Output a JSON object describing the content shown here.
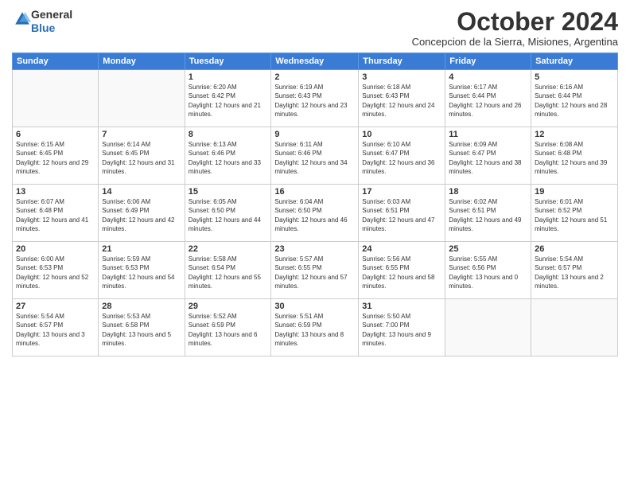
{
  "header": {
    "logo_general": "General",
    "logo_blue": "Blue",
    "month": "October 2024",
    "location": "Concepcion de la Sierra, Misiones, Argentina"
  },
  "weekdays": [
    "Sunday",
    "Monday",
    "Tuesday",
    "Wednesday",
    "Thursday",
    "Friday",
    "Saturday"
  ],
  "weeks": [
    [
      {
        "day": "",
        "sunrise": "",
        "sunset": "",
        "daylight": ""
      },
      {
        "day": "",
        "sunrise": "",
        "sunset": "",
        "daylight": ""
      },
      {
        "day": "1",
        "sunrise": "Sunrise: 6:20 AM",
        "sunset": "Sunset: 6:42 PM",
        "daylight": "Daylight: 12 hours and 21 minutes."
      },
      {
        "day": "2",
        "sunrise": "Sunrise: 6:19 AM",
        "sunset": "Sunset: 6:43 PM",
        "daylight": "Daylight: 12 hours and 23 minutes."
      },
      {
        "day": "3",
        "sunrise": "Sunrise: 6:18 AM",
        "sunset": "Sunset: 6:43 PM",
        "daylight": "Daylight: 12 hours and 24 minutes."
      },
      {
        "day": "4",
        "sunrise": "Sunrise: 6:17 AM",
        "sunset": "Sunset: 6:44 PM",
        "daylight": "Daylight: 12 hours and 26 minutes."
      },
      {
        "day": "5",
        "sunrise": "Sunrise: 6:16 AM",
        "sunset": "Sunset: 6:44 PM",
        "daylight": "Daylight: 12 hours and 28 minutes."
      }
    ],
    [
      {
        "day": "6",
        "sunrise": "Sunrise: 6:15 AM",
        "sunset": "Sunset: 6:45 PM",
        "daylight": "Daylight: 12 hours and 29 minutes."
      },
      {
        "day": "7",
        "sunrise": "Sunrise: 6:14 AM",
        "sunset": "Sunset: 6:45 PM",
        "daylight": "Daylight: 12 hours and 31 minutes."
      },
      {
        "day": "8",
        "sunrise": "Sunrise: 6:13 AM",
        "sunset": "Sunset: 6:46 PM",
        "daylight": "Daylight: 12 hours and 33 minutes."
      },
      {
        "day": "9",
        "sunrise": "Sunrise: 6:11 AM",
        "sunset": "Sunset: 6:46 PM",
        "daylight": "Daylight: 12 hours and 34 minutes."
      },
      {
        "day": "10",
        "sunrise": "Sunrise: 6:10 AM",
        "sunset": "Sunset: 6:47 PM",
        "daylight": "Daylight: 12 hours and 36 minutes."
      },
      {
        "day": "11",
        "sunrise": "Sunrise: 6:09 AM",
        "sunset": "Sunset: 6:47 PM",
        "daylight": "Daylight: 12 hours and 38 minutes."
      },
      {
        "day": "12",
        "sunrise": "Sunrise: 6:08 AM",
        "sunset": "Sunset: 6:48 PM",
        "daylight": "Daylight: 12 hours and 39 minutes."
      }
    ],
    [
      {
        "day": "13",
        "sunrise": "Sunrise: 6:07 AM",
        "sunset": "Sunset: 6:48 PM",
        "daylight": "Daylight: 12 hours and 41 minutes."
      },
      {
        "day": "14",
        "sunrise": "Sunrise: 6:06 AM",
        "sunset": "Sunset: 6:49 PM",
        "daylight": "Daylight: 12 hours and 42 minutes."
      },
      {
        "day": "15",
        "sunrise": "Sunrise: 6:05 AM",
        "sunset": "Sunset: 6:50 PM",
        "daylight": "Daylight: 12 hours and 44 minutes."
      },
      {
        "day": "16",
        "sunrise": "Sunrise: 6:04 AM",
        "sunset": "Sunset: 6:50 PM",
        "daylight": "Daylight: 12 hours and 46 minutes."
      },
      {
        "day": "17",
        "sunrise": "Sunrise: 6:03 AM",
        "sunset": "Sunset: 6:51 PM",
        "daylight": "Daylight: 12 hours and 47 minutes."
      },
      {
        "day": "18",
        "sunrise": "Sunrise: 6:02 AM",
        "sunset": "Sunset: 6:51 PM",
        "daylight": "Daylight: 12 hours and 49 minutes."
      },
      {
        "day": "19",
        "sunrise": "Sunrise: 6:01 AM",
        "sunset": "Sunset: 6:52 PM",
        "daylight": "Daylight: 12 hours and 51 minutes."
      }
    ],
    [
      {
        "day": "20",
        "sunrise": "Sunrise: 6:00 AM",
        "sunset": "Sunset: 6:53 PM",
        "daylight": "Daylight: 12 hours and 52 minutes."
      },
      {
        "day": "21",
        "sunrise": "Sunrise: 5:59 AM",
        "sunset": "Sunset: 6:53 PM",
        "daylight": "Daylight: 12 hours and 54 minutes."
      },
      {
        "day": "22",
        "sunrise": "Sunrise: 5:58 AM",
        "sunset": "Sunset: 6:54 PM",
        "daylight": "Daylight: 12 hours and 55 minutes."
      },
      {
        "day": "23",
        "sunrise": "Sunrise: 5:57 AM",
        "sunset": "Sunset: 6:55 PM",
        "daylight": "Daylight: 12 hours and 57 minutes."
      },
      {
        "day": "24",
        "sunrise": "Sunrise: 5:56 AM",
        "sunset": "Sunset: 6:55 PM",
        "daylight": "Daylight: 12 hours and 58 minutes."
      },
      {
        "day": "25",
        "sunrise": "Sunrise: 5:55 AM",
        "sunset": "Sunset: 6:56 PM",
        "daylight": "Daylight: 13 hours and 0 minutes."
      },
      {
        "day": "26",
        "sunrise": "Sunrise: 5:54 AM",
        "sunset": "Sunset: 6:57 PM",
        "daylight": "Daylight: 13 hours and 2 minutes."
      }
    ],
    [
      {
        "day": "27",
        "sunrise": "Sunrise: 5:54 AM",
        "sunset": "Sunset: 6:57 PM",
        "daylight": "Daylight: 13 hours and 3 minutes."
      },
      {
        "day": "28",
        "sunrise": "Sunrise: 5:53 AM",
        "sunset": "Sunset: 6:58 PM",
        "daylight": "Daylight: 13 hours and 5 minutes."
      },
      {
        "day": "29",
        "sunrise": "Sunrise: 5:52 AM",
        "sunset": "Sunset: 6:59 PM",
        "daylight": "Daylight: 13 hours and 6 minutes."
      },
      {
        "day": "30",
        "sunrise": "Sunrise: 5:51 AM",
        "sunset": "Sunset: 6:59 PM",
        "daylight": "Daylight: 13 hours and 8 minutes."
      },
      {
        "day": "31",
        "sunrise": "Sunrise: 5:50 AM",
        "sunset": "Sunset: 7:00 PM",
        "daylight": "Daylight: 13 hours and 9 minutes."
      },
      {
        "day": "",
        "sunrise": "",
        "sunset": "",
        "daylight": ""
      },
      {
        "day": "",
        "sunrise": "",
        "sunset": "",
        "daylight": ""
      }
    ]
  ]
}
